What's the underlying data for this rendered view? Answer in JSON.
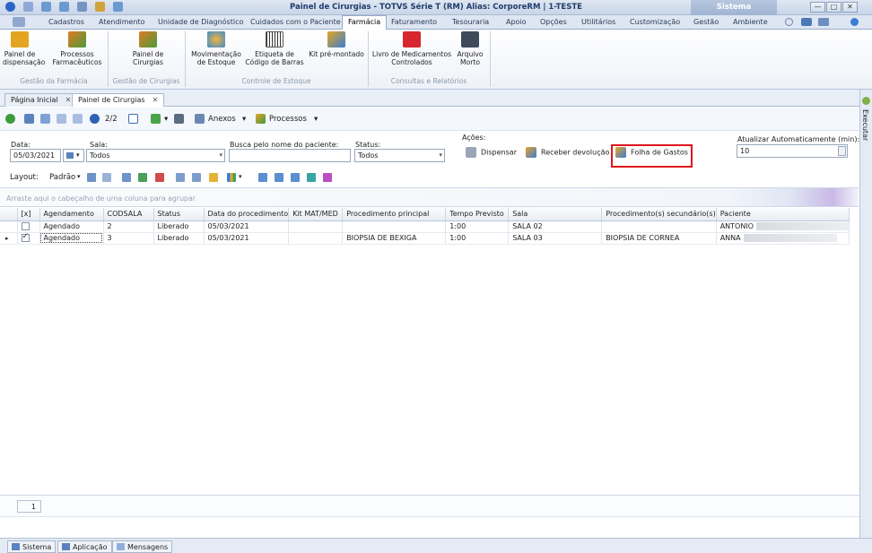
{
  "window": {
    "title": "Painel de Cirurgias - TOTVS Série T  (RM) Alias: CorporeRM | 1-TESTE",
    "context_tab": "Sistema",
    "controls": [
      "—",
      "□",
      "✕"
    ]
  },
  "menu_tabs": [
    "Cadastros",
    "Atendimento",
    "Unidade de Diagnóstico",
    "Cuidados com o Paciente",
    "Farmácia",
    "Faturamento",
    "Tesouraria",
    "Apoio",
    "Opções",
    "Utilitários",
    "Customização",
    "Gestão",
    "Ambiente"
  ],
  "active_menu_tab": "Farmácia",
  "ribbon": {
    "painel_dispensacao": "Painel de\ndispensação",
    "processos_farmaceuticos": "Processos\nFarmacêuticos",
    "painel_cirurgias": "Painel de\nCirurgias",
    "movimentacao_estoque": "Movimentação\nde Estoque",
    "etiqueta_codigo_barras": "Etiqueta de\nCódigo de Barras",
    "kit_pre_montado": "Kit pré-montado",
    "livro_medicamentos": "Livro de Medicamentos\nControlados",
    "arquivo_morto": "Arquivo\nMorto",
    "groups": {
      "gestao_farmacia": "Gestão da Farmácia",
      "gestao_cirurgias": "Gestão de Cirurgias",
      "controle_estoque": "Controle de Estoque",
      "consultas_relatorios": "Consultas e Relatórios"
    }
  },
  "doc_tabs": [
    {
      "label": "Página Inicial",
      "close": "✕"
    },
    {
      "label": "Painel de Cirurgias",
      "close": "✕"
    }
  ],
  "execbar": {
    "label": "Executar"
  },
  "toolbar": {
    "record_pos": "2/2",
    "anexos": "Anexos",
    "processos": "Processos",
    "dropdown_arrow": "▾"
  },
  "filters": {
    "data_label": "Data:",
    "data_value": "05/03/2021",
    "sala_label": "Sala:",
    "sala_value": "Todos",
    "busca_label": "Busca pelo nome do paciente:",
    "busca_value": "",
    "status_label": "Status:",
    "status_value": "Todos"
  },
  "acoes": {
    "label": "Ações:",
    "dispensar": "Dispensar",
    "receber_devolucao": "Receber devolução",
    "folha_gastos": "Folha de Gastos"
  },
  "auto_update": {
    "label": "Atualizar Automaticamente (min):",
    "value": "10"
  },
  "layout": {
    "label": "Layout:",
    "value": "Padrão"
  },
  "group_panel_hint": "Arraste aqui o cabeçalho de uma coluna para agrupar",
  "grid": {
    "columns": [
      "[x]",
      "Agendamento",
      "CODSALA",
      "Status",
      "Data do procedimento",
      "Kit MAT/MED",
      "Procedimento principal",
      "Tempo Previsto",
      "Sala",
      "Procedimento(s) secundário(s)",
      "Paciente"
    ],
    "rows": [
      {
        "checked": false,
        "agendamento": "Agendado",
        "codsala": "2",
        "status": "Liberado",
        "data": "05/03/2021",
        "kit": "",
        "proc_principal": "",
        "tempo": "1:00",
        "sala": "SALA 02",
        "proc_secundario": "",
        "paciente": "ANTONIO"
      },
      {
        "checked": true,
        "agendamento": "Agendado",
        "codsala": "3",
        "status": "Liberado",
        "data": "05/03/2021",
        "kit": "",
        "proc_principal": "BIOPSIA DE BEXIGA",
        "tempo": "1:00",
        "sala": "SALA 03",
        "proc_secundario": "BIOPSIA DE CORNEA",
        "paciente": "ANNA"
      }
    ],
    "current_row_marker": "▸"
  },
  "pager": {
    "value": "1"
  },
  "bottom_tabs": [
    "Sistema",
    "Aplicação",
    "Mensagens"
  ],
  "colors": {
    "highlight_box": "#e0151b",
    "ribbon_blue": "#1f3c6b"
  }
}
